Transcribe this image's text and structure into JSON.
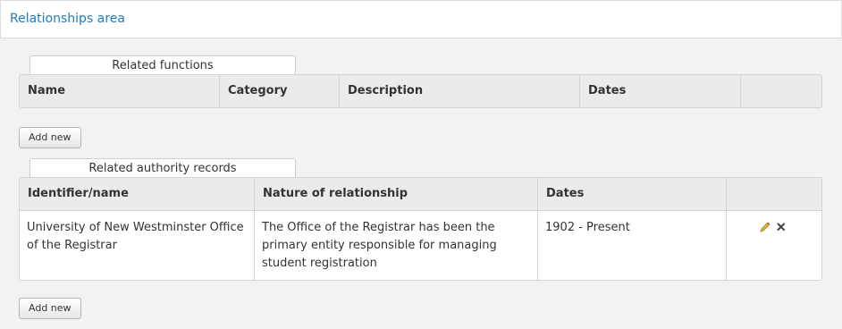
{
  "header": {
    "title": "Relationships area"
  },
  "functions": {
    "caption": "Related functions",
    "columns": [
      "Name",
      "Category",
      "Description",
      "Dates",
      ""
    ],
    "add_label": "Add new"
  },
  "authority": {
    "caption": "Related authority records",
    "columns": [
      "Identifier/name",
      "Nature of relationship",
      "Dates",
      ""
    ],
    "rows": [
      {
        "identifier": "University of New Westminster Office of the Registrar",
        "nature": "The Office of the Registrar has been the primary entity responsible for managing student registration",
        "dates": "1902 - Present"
      }
    ],
    "add_label": "Add new"
  },
  "icons": {
    "edit": "pencil-icon",
    "delete": "close-icon"
  },
  "colors": {
    "accent": "#1f7bc0",
    "header_bg": "#ebebeb",
    "page_bg": "#f2f2f2"
  }
}
